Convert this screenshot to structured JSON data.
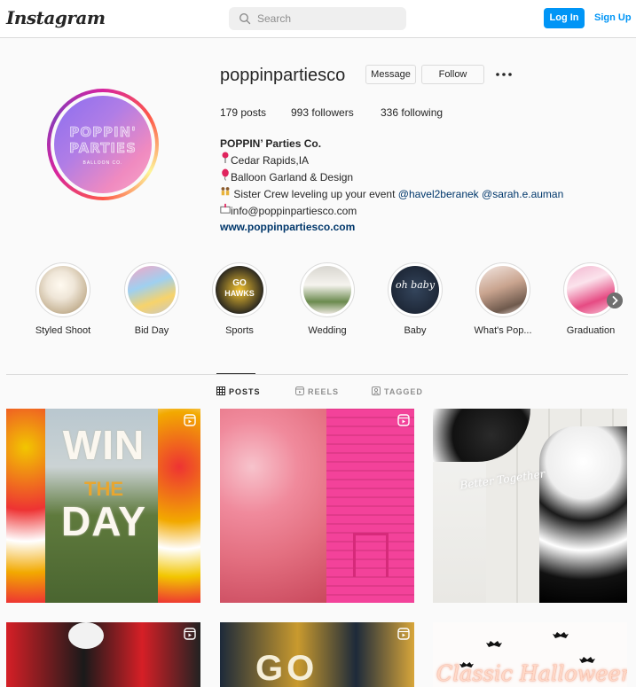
{
  "app": {
    "logo": "Instagram"
  },
  "nav": {
    "search_placeholder": "Search",
    "login_label": "Log In",
    "signup_label": "Sign Up"
  },
  "profile": {
    "username": "poppinpartiesco",
    "message_label": "Message",
    "follow_label": "Follow",
    "stats": {
      "posts_count": "179",
      "posts_label": " posts",
      "followers_count": "993",
      "followers_label": " followers",
      "following_count": "336",
      "following_label": " following"
    },
    "avatar": {
      "line1": "POPPIN'",
      "line2": "PARTIES",
      "sub": "BALLOON CO."
    },
    "bio": {
      "name": "POPPIN’ Parties Co.",
      "location": "Cedar Rapids,IA",
      "service": "Balloon Garland & Design",
      "crew_text": " Sister Crew leveling up your event ",
      "mention1": "@havel2beranek",
      "mention2": "@sarah.e.auman",
      "email": "info@poppinpartiesco.com",
      "website": "www.poppinpartiesco.com"
    }
  },
  "highlights": [
    {
      "label": "Styled Shoot"
    },
    {
      "label": "Bid Day"
    },
    {
      "label": "Sports"
    },
    {
      "label": "Wedding"
    },
    {
      "label": "Baby"
    },
    {
      "label": "What's Pop..."
    },
    {
      "label": "Graduation"
    }
  ],
  "highlight_texts": {
    "sports_line1": "GO",
    "sports_line2": "HAWKS",
    "baby_text": "oh baby"
  },
  "tabs": [
    {
      "label": "POSTS",
      "active": true
    },
    {
      "label": "REELS",
      "active": false
    },
    {
      "label": "TAGGED",
      "active": false
    }
  ],
  "posts": [
    {
      "text1": "WIN",
      "text2": "THE",
      "text3": "DAY",
      "is_reel": true
    },
    {
      "is_reel": true
    },
    {
      "neon": "Better Together",
      "is_reel": false
    },
    {
      "is_reel": true
    },
    {
      "text1": "GO",
      "is_reel": true
    },
    {
      "neon": "Classic Halloween",
      "is_reel": false
    }
  ],
  "colors": {
    "accent": "#0095f6",
    "link": "#00376b",
    "border": "#dbdbdb",
    "background": "#fafafa"
  },
  "icons": {
    "search": "search-icon",
    "more": "more-options-icon",
    "reel": "reel-icon",
    "grid": "grid-icon",
    "next": "chevron-right-icon"
  }
}
